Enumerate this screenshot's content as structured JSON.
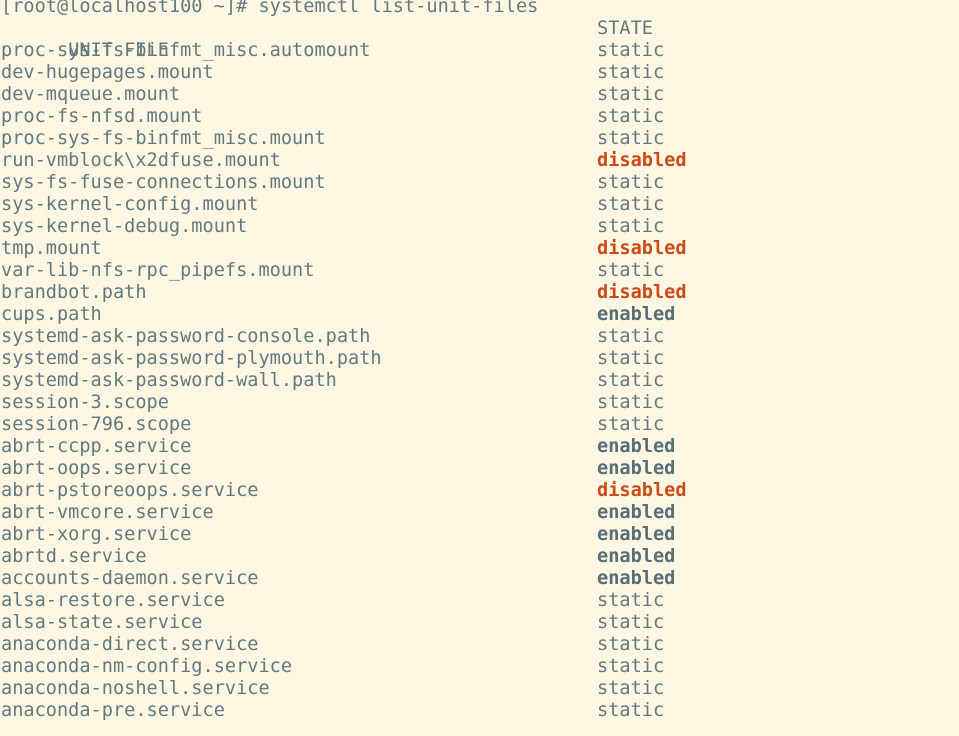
{
  "terminal": {
    "background_color": "#fdf6e3",
    "foreground_color": "#62797f",
    "enabled_color": "#566f77",
    "disabled_color": "#cb4b16",
    "prompt_line": "[root@localhost100 ~]# systemctl list-unit-files",
    "scroll_artifact": "~"
  },
  "table": {
    "headers": {
      "unit_file": "UNIT FILE",
      "state": "STATE"
    },
    "rows": [
      {
        "unit": "proc-sys-fs-binfmt_misc.automount",
        "state": "static"
      },
      {
        "unit": "dev-hugepages.mount",
        "state": "static"
      },
      {
        "unit": "dev-mqueue.mount",
        "state": "static"
      },
      {
        "unit": "proc-fs-nfsd.mount",
        "state": "static"
      },
      {
        "unit": "proc-sys-fs-binfmt_misc.mount",
        "state": "static"
      },
      {
        "unit": "run-vmblock\\x2dfuse.mount",
        "state": "disabled"
      },
      {
        "unit": "sys-fs-fuse-connections.mount",
        "state": "static"
      },
      {
        "unit": "sys-kernel-config.mount",
        "state": "static"
      },
      {
        "unit": "sys-kernel-debug.mount",
        "state": "static"
      },
      {
        "unit": "tmp.mount",
        "state": "disabled"
      },
      {
        "unit": "var-lib-nfs-rpc_pipefs.mount",
        "state": "static"
      },
      {
        "unit": "brandbot.path",
        "state": "disabled"
      },
      {
        "unit": "cups.path",
        "state": "enabled"
      },
      {
        "unit": "systemd-ask-password-console.path",
        "state": "static"
      },
      {
        "unit": "systemd-ask-password-plymouth.path",
        "state": "static"
      },
      {
        "unit": "systemd-ask-password-wall.path",
        "state": "static"
      },
      {
        "unit": "session-3.scope",
        "state": "static"
      },
      {
        "unit": "session-796.scope",
        "state": "static"
      },
      {
        "unit": "abrt-ccpp.service",
        "state": "enabled"
      },
      {
        "unit": "abrt-oops.service",
        "state": "enabled"
      },
      {
        "unit": "abrt-pstoreoops.service",
        "state": "disabled"
      },
      {
        "unit": "abrt-vmcore.service",
        "state": "enabled"
      },
      {
        "unit": "abrt-xorg.service",
        "state": "enabled"
      },
      {
        "unit": "abrtd.service",
        "state": "enabled"
      },
      {
        "unit": "accounts-daemon.service",
        "state": "enabled"
      },
      {
        "unit": "alsa-restore.service",
        "state": "static"
      },
      {
        "unit": "alsa-state.service",
        "state": "static"
      },
      {
        "unit": "anaconda-direct.service",
        "state": "static"
      },
      {
        "unit": "anaconda-nm-config.service",
        "state": "static"
      },
      {
        "unit": "anaconda-noshell.service",
        "state": "static"
      },
      {
        "unit": "anaconda-pre.service",
        "state": "static"
      }
    ]
  }
}
